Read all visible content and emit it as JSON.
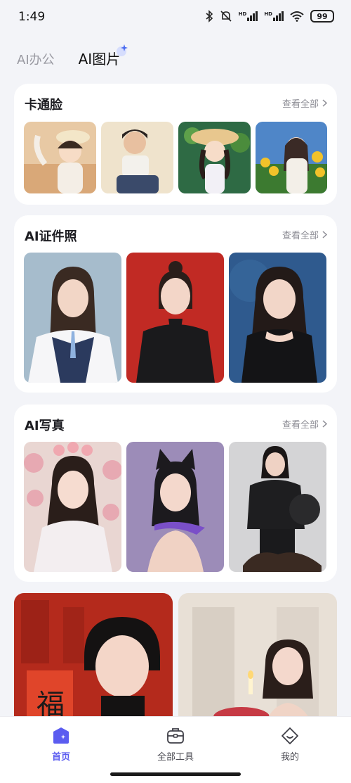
{
  "status": {
    "time": "1:49",
    "battery": "99",
    "network_1": "HD",
    "network_2": "HD"
  },
  "tabs": [
    {
      "label": "AI办公"
    },
    {
      "label": "AI图片"
    }
  ],
  "sections": [
    {
      "title": "卡通脸",
      "see_all": "查看全部"
    },
    {
      "title": "AI证件照",
      "see_all": "查看全部"
    },
    {
      "title": "AI写真",
      "see_all": "查看全部"
    }
  ],
  "nav": [
    {
      "label": "首页",
      "icon": "home-icon"
    },
    {
      "label": "全部工具",
      "icon": "toolbox-icon"
    },
    {
      "label": "我的",
      "icon": "profile-icon"
    }
  ],
  "colors": {
    "accent": "#5b5cf0",
    "background": "#f3f4f8"
  }
}
